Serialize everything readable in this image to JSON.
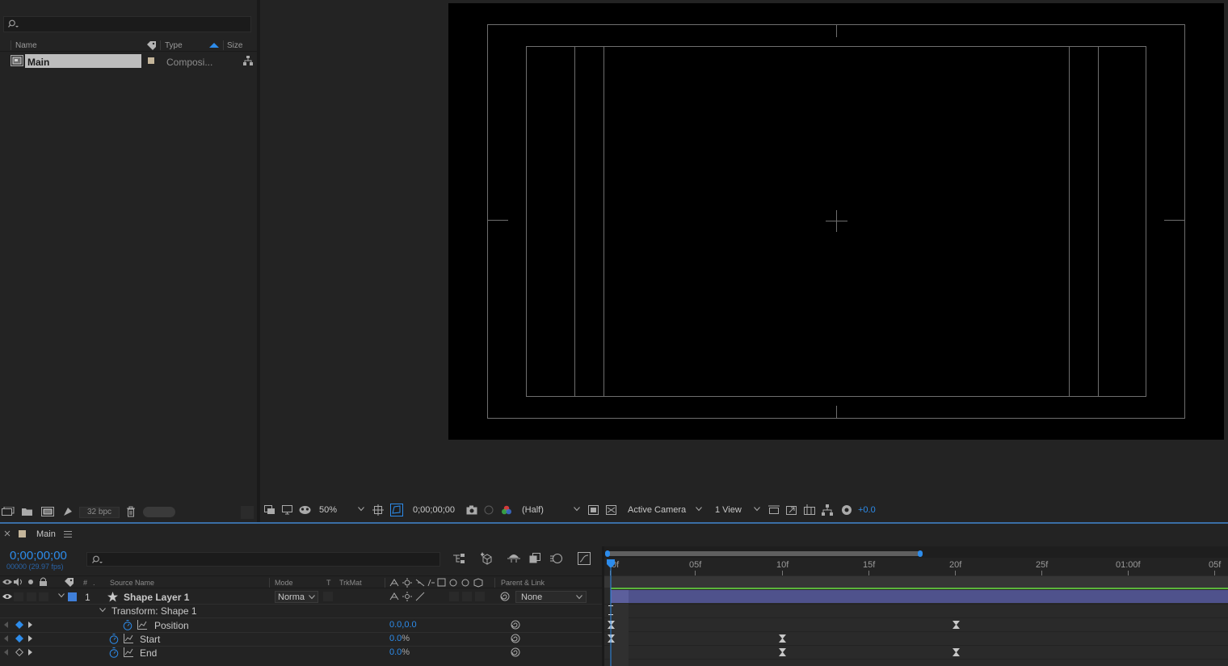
{
  "project": {
    "search_placeholder": "",
    "columns": {
      "name": "Name",
      "type": "Type",
      "size": "Size"
    },
    "items": [
      {
        "name": "Main",
        "type": "Composi..."
      }
    ],
    "footer": {
      "bpc": "32 bpc"
    }
  },
  "viewer": {
    "zoom": "50%",
    "timecode": "0;00;00;00",
    "resolution": "(Half)",
    "camera": "Active Camera",
    "views": "1 View",
    "exposure": "+0.0"
  },
  "timeline": {
    "tab_title": "Main",
    "timecode": "0;00;00;00",
    "frame_info": "00000 (29.97 fps)",
    "columns": {
      "hash": "#",
      "source_name": "Source Name",
      "mode": "Mode",
      "t": "T",
      "trkmat": "TrkMat",
      "parent": "Parent & Link"
    },
    "layer": {
      "number": "1",
      "name": "Shape Layer 1",
      "mode": "Norma",
      "parent": "None",
      "label_color": "#3f7fd9"
    },
    "group": {
      "name": "Transform: Shape 1"
    },
    "properties": [
      {
        "name": "Position",
        "value": "0.0,0.0",
        "unit": ""
      },
      {
        "name": "Start",
        "value": "0.0",
        "unit": "%"
      },
      {
        "name": "End",
        "value": "0.0",
        "unit": "%"
      }
    ],
    "ruler": [
      "0f",
      "05f",
      "10f",
      "15f",
      "20f",
      "25f",
      "01:00f",
      "05f"
    ]
  }
}
